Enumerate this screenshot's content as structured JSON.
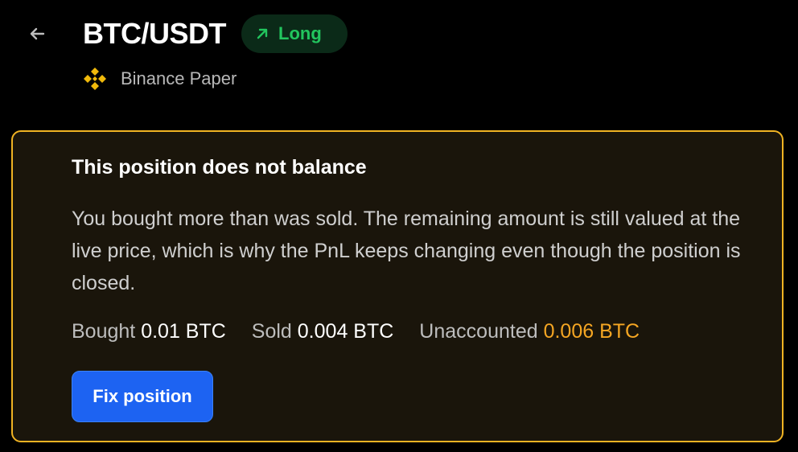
{
  "header": {
    "back_icon": "arrow-left-icon",
    "pair": "BTC/USDT",
    "side_badge": {
      "icon": "arrow-up-right-icon",
      "label": "Long",
      "color": "#22c55e"
    },
    "exchange": {
      "icon": "binance-logo-icon",
      "name": "Binance Paper"
    }
  },
  "warning_card": {
    "accent_color": "#f0b323",
    "title": "This position does not balance",
    "body": "You bought more than was sold. The remaining amount is still valued at the live price, which is why the PnL keeps changing even though the position is closed.",
    "stats": {
      "bought_label": "Bought",
      "bought_value": "0.01 BTC",
      "sold_label": "Sold",
      "sold_value": "0.004 BTC",
      "unaccounted_label": "Unaccounted",
      "unaccounted_value": "0.006 BTC"
    },
    "action_label": "Fix position",
    "action_color": "#1d63f2"
  }
}
